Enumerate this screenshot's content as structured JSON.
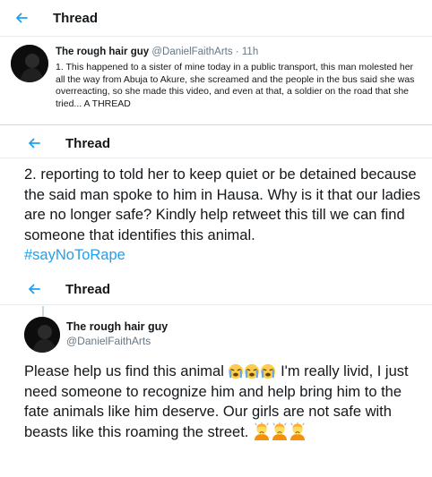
{
  "colors": {
    "accent": "#1da1f2",
    "text": "#14171a",
    "secondary": "#657786",
    "border": "#e6ecf0"
  },
  "screen1": {
    "back_icon": "arrow-left-icon",
    "title": "Thread",
    "tweet": {
      "name": "The rough hair guy",
      "handle": "@DanielFaithArts",
      "separator": "·",
      "time": "11h",
      "text": "1. This happened to a sister of mine today in a public transport, this man molested her all the way from Abuja to Akure, she screamed and the people in the bus said she was overreacting, so she made this video, and even at that, a soldier on the road that she tried... A THREAD"
    }
  },
  "screen2": {
    "back_icon": "arrow-left-icon",
    "title": "Thread",
    "text": "2. reporting to told her to keep quiet or be detained because the said man spoke to him in Hausa. Why is it that our ladies are no longer safe? Kindly help retweet this till we can find someone that identifies this animal.",
    "hashtag": "#sayNoToRape"
  },
  "screen3": {
    "back_icon": "arrow-left-icon",
    "title": "Thread",
    "tweet": {
      "name": "The rough hair guy",
      "handle": "@DanielFaithArts",
      "text_before": "Please help us find this animal",
      "crying_emoji_icon": "loudly-crying-face-icon",
      "text_after": "I'm really livid, I just need someone to recognize him and help bring him to the fate animals like him deserve. Our girls are not safe with beasts like this roaming the street.",
      "frustrated_emoji_icon": "person-frowning-icon"
    }
  }
}
